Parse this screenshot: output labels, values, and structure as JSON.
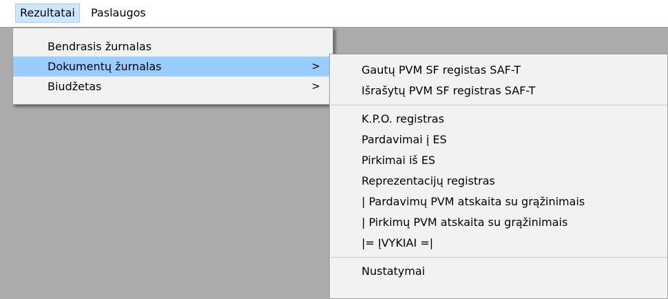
{
  "menubar": {
    "items": [
      {
        "label": "Rezultatai"
      },
      {
        "label": "Paslaugos"
      }
    ]
  },
  "main_menu": {
    "items": [
      {
        "label": "Bendrasis žurnalas",
        "has_submenu": false
      },
      {
        "label": "Dokumentų žurnalas",
        "has_submenu": true,
        "arrow": ">"
      },
      {
        "label": "Biudžetas",
        "has_submenu": true,
        "arrow": ">"
      }
    ]
  },
  "sub_menu": {
    "group1": [
      {
        "label": "Gautų PVM SF registas SAF-T"
      },
      {
        "label": "Išrašytų PVM SF registras SAF-T"
      }
    ],
    "group2": [
      {
        "label": "K.P.O. registras"
      },
      {
        "label": "Pardavimai į ES"
      },
      {
        "label": "Pirkimai iš ES"
      },
      {
        "label": "Reprezentacijų registras"
      },
      {
        "label": "| Pardavimų PVM atskaita su grąžinimais"
      },
      {
        "label": "| Pirkimų PVM atskaita su grąžinimais"
      },
      {
        "label": "|= ĮVYKIAI =|"
      }
    ],
    "group3": [
      {
        "label": "Nustatymai"
      }
    ]
  },
  "colors": {
    "background": "#ababab",
    "menu_bg": "#f2f2f2",
    "highlight": "#99cdff",
    "menubar_active": "#cce8ff"
  }
}
